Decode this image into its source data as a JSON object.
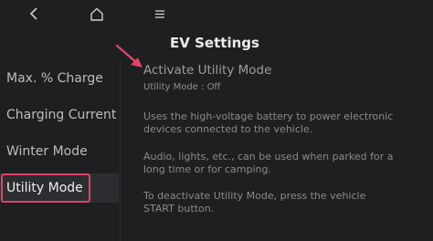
{
  "topbar": {
    "back_icon": "back-chevron-icon",
    "home_icon": "home-icon",
    "menu_icon": "menu-icon"
  },
  "page": {
    "title": "EV Settings"
  },
  "sidebar": {
    "items": [
      {
        "label": "Max. % Charge",
        "selected": false
      },
      {
        "label": "Charging Current",
        "selected": false
      },
      {
        "label": "Winter Mode",
        "selected": false
      },
      {
        "label": "Utility Mode",
        "selected": true
      }
    ]
  },
  "content": {
    "setting_title": "Activate Utility Mode",
    "setting_status": "Utility Mode : Off",
    "description": [
      {
        "line1": "Uses the high-voltage battery to power electronic",
        "line2": "devices connected to the vehicle."
      },
      {
        "line1": "Audio, lights, etc., can be used when parked for a",
        "line2": "long time or for camping."
      },
      {
        "line1": "To deactivate Utility Mode, press the vehicle",
        "line2": "START button."
      }
    ]
  },
  "colors": {
    "background": "#1e1f21",
    "annotation": "#e0426a"
  }
}
